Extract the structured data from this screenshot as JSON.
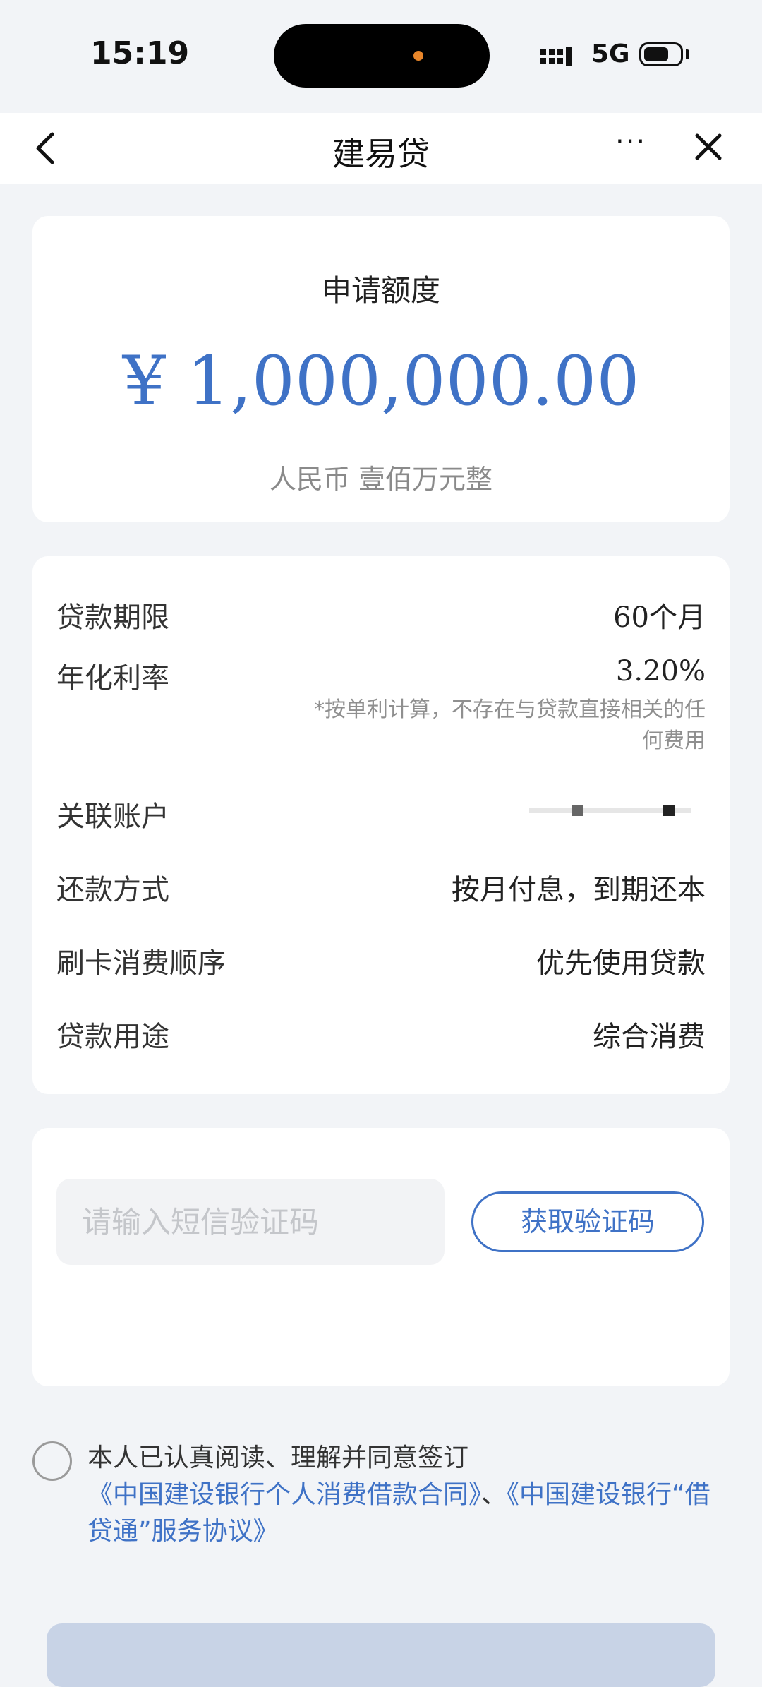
{
  "status_bar": {
    "time": "15:19",
    "network": "5G"
  },
  "nav": {
    "title": "建易贷",
    "more": "···"
  },
  "amount_card": {
    "label": "申请额度",
    "value": "¥ 1,000,000.00",
    "in_words": "人民币 壹佰万元整"
  },
  "details": {
    "term_label": "贷款期限",
    "term_value": "60个月",
    "rate_label": "年化利率",
    "rate_value": "3.20%",
    "rate_note": "*按单利计算，不存在与贷款直接相关的任何费用",
    "account_label": "关联账户",
    "repay_label": "还款方式",
    "repay_value": "按月付息，到期还本",
    "order_label": "刷卡消费顺序",
    "order_value": "优先使用贷款",
    "purpose_label": "贷款用途",
    "purpose_value": "综合消费"
  },
  "sms": {
    "placeholder": "请输入短信验证码",
    "button": "获取验证码"
  },
  "agreement": {
    "prefix": "本人已认真阅读、理解并同意签订",
    "contract_link": "《中国建设银行个人消费借款合同》",
    "separator": "、",
    "service_link": "《中国建设银行“借贷通”服务协议》"
  },
  "colors": {
    "accent": "#3f72c6",
    "background": "#f2f4f7"
  }
}
